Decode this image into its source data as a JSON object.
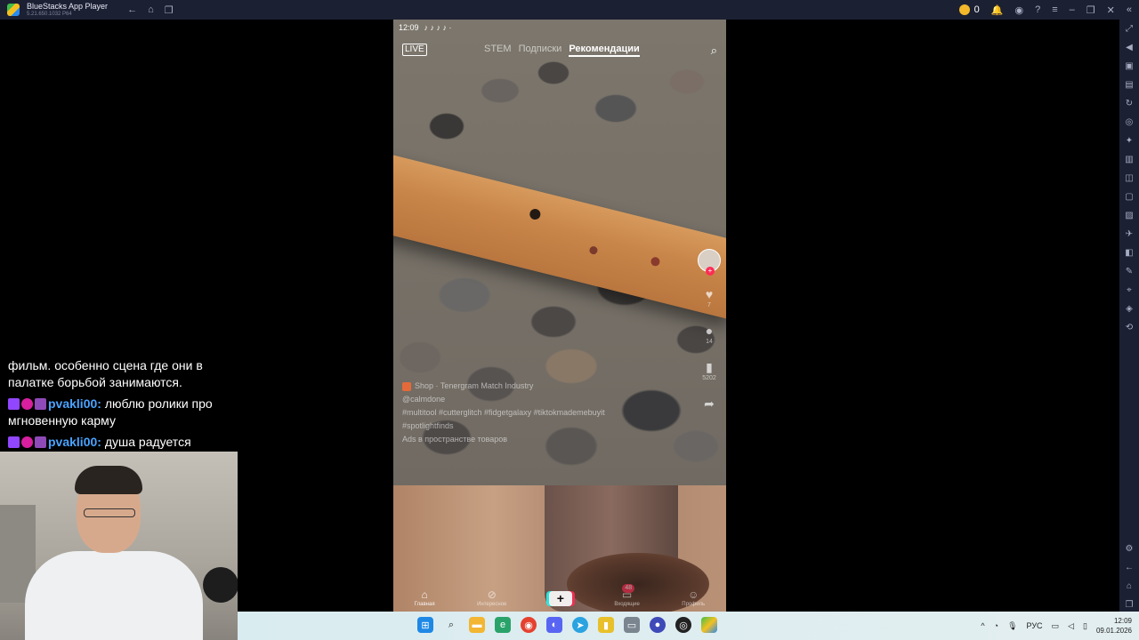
{
  "window": {
    "app_title": "BlueStacks App Player",
    "app_version": "5.21.650.1032 P64",
    "coins": "0"
  },
  "phone": {
    "status_time": "12:09",
    "live_label": "LIVE",
    "tabs": [
      "STEM",
      "Подписки",
      "Рекомендации"
    ],
    "active_tab": "Рекомендации",
    "shop_line": "Shop · Tenergram Match Industry",
    "caption_user": "@calmdone",
    "caption_tags": "#multitool #cutterglitch #fidgetgalaxy #tiktokmademebuyit",
    "caption_tags2": "#spotlightfinds",
    "caption_more": "Ads в пространстве товаров",
    "like_count": "7",
    "comment_count": "14",
    "save_count": "5202",
    "bottom_nav": {
      "home": "Главная",
      "discover": "Интересное",
      "inbox": "Входящие",
      "inbox_badge": "48",
      "profile": "Профиль"
    }
  },
  "chat": {
    "messages": [
      {
        "user": "",
        "text": "фильм. особенно сцена где они в палатке борьбой занимаются."
      },
      {
        "user": "pvakli00:",
        "text": " люблю ролики про мгновенную карму"
      },
      {
        "user": "pvakli00:",
        "text": " душа радуется"
      }
    ]
  },
  "taskbar": {
    "lang": "РУС",
    "time": "12:09",
    "date": "09.01.2026"
  },
  "colors": {
    "titlebar": "#1c2033",
    "username": "#4aa3ff",
    "tiktok_red": "#fe2c55"
  }
}
